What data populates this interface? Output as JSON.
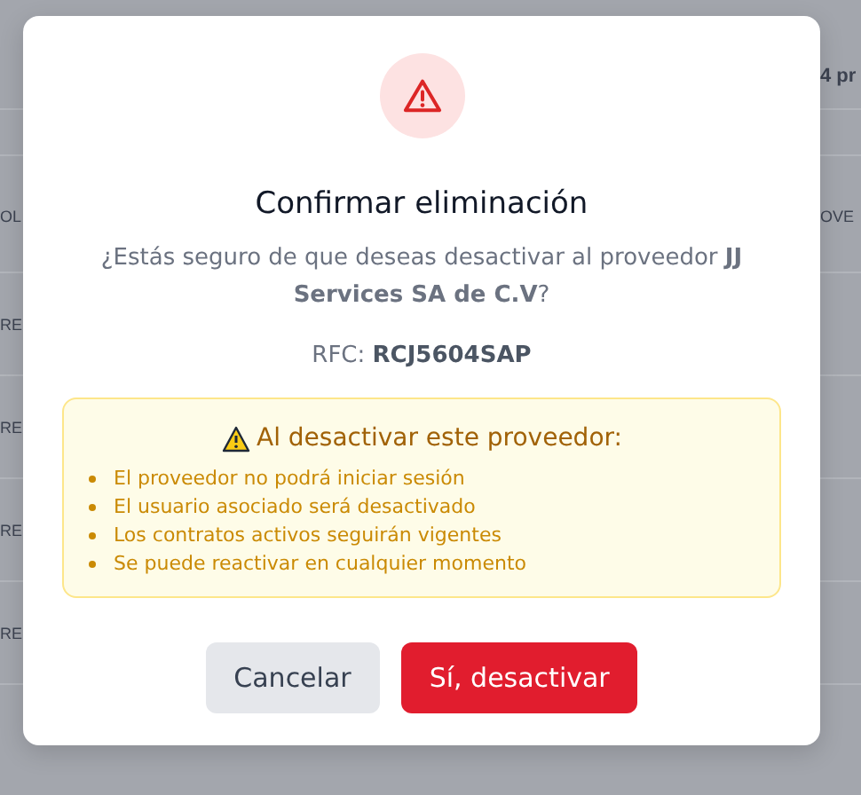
{
  "background": {
    "count_text": "4 pr",
    "header_left": "OL",
    "header_right": "OVE",
    "rows": [
      "RE",
      "RE",
      "RE",
      "RE"
    ]
  },
  "dialog": {
    "title": "Confirmar eliminación",
    "message": "¿Estás seguro de que deseas desactivar al proveedor **JJ Services SA de C.V**?",
    "rfc_label": "RFC:",
    "rfc_value": "RCJ5604SAP",
    "warning": {
      "title": "Al desactivar este proveedor:",
      "items": [
        "El proveedor no podrá iniciar sesión",
        "El usuario asociado será desactivado",
        "Los contratos activos seguirán vigentes",
        "Se puede reactivar en cualquier momento"
      ]
    },
    "buttons": [
      {
        "label": "Cancelar",
        "kind": "secondary"
      },
      {
        "label": "Sí, desactivar",
        "kind": "danger"
      }
    ]
  }
}
